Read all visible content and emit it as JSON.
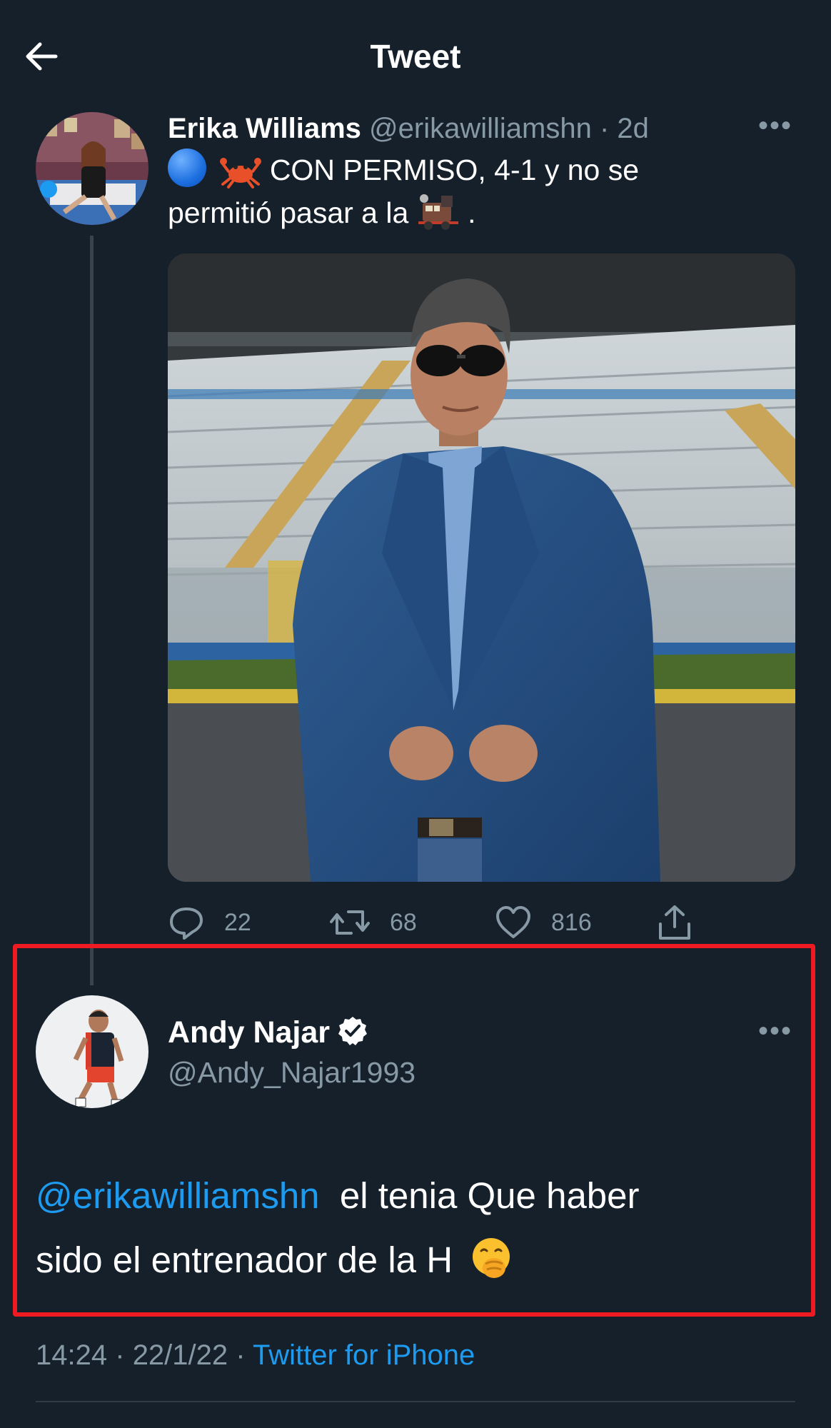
{
  "header": {
    "title": "Tweet",
    "back_icon": "back-arrow-icon"
  },
  "tweet1": {
    "name": "Erika Williams",
    "handle": "@erikawilliamshn",
    "separator": "·",
    "time": "2d",
    "more": "•••",
    "text_line1": "CON PERMISO, 4-1 y no se",
    "text_line2": "permitió pasar a la",
    "text_end": ".",
    "emojis": [
      "blue-circle-icon",
      "crab-icon",
      "train-icon"
    ],
    "stats": {
      "replies": "22",
      "retweets": "68",
      "likes": "816"
    }
  },
  "tweet2": {
    "name": "Andy Najar",
    "handle": "@Andy_Najar1993",
    "more": "•••",
    "mention": "@erikawilliamshn",
    "text_part1": "el tenia Que haber",
    "text_part2": "sido el entrenador de la H",
    "emoji": "face-with-hand-over-mouth-icon"
  },
  "footer": {
    "time": "14:24",
    "sep1": "·",
    "date": "22/1/22",
    "sep2": "·",
    "source": "Twitter for iPhone"
  },
  "colors": {
    "background": "#15202b",
    "link": "#1d9bf0",
    "muted": "#8899a6",
    "highlight": "#ee1c22"
  }
}
